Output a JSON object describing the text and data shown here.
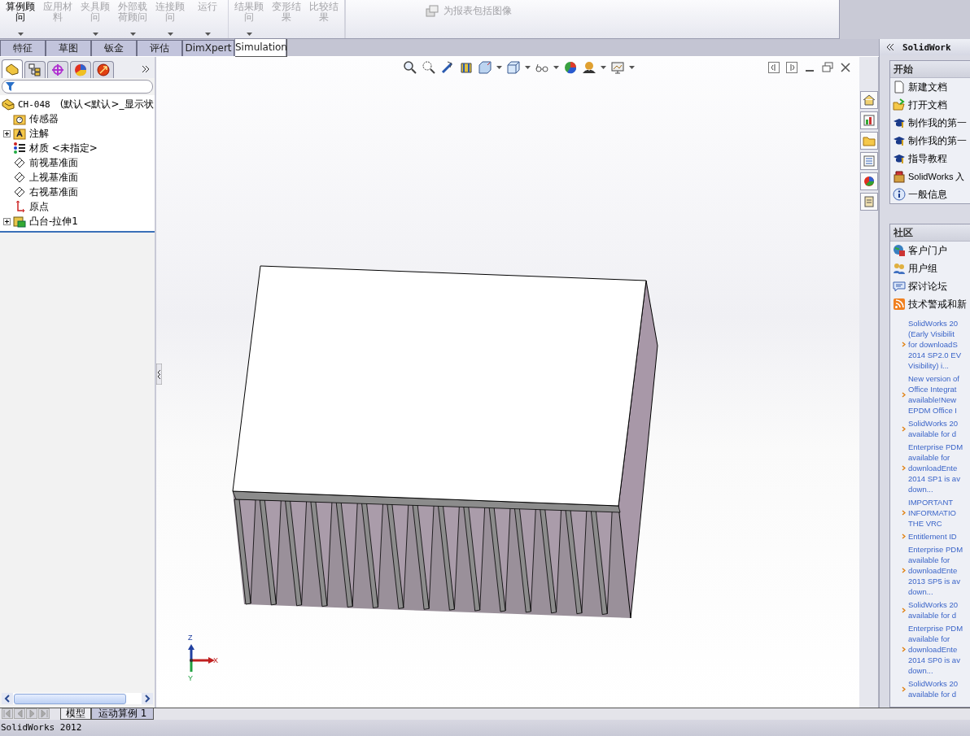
{
  "ribbon": {
    "groups": [
      {
        "buttons": [
          {
            "label": "算例顾问",
            "disabled": false,
            "dropdown": true
          },
          {
            "label": "应用材料",
            "disabled": true,
            "dropdown": false
          },
          {
            "label": "夹具顾问",
            "disabled": true,
            "dropdown": true
          },
          {
            "label": "外部载荷顾问",
            "disabled": true,
            "dropdown": true
          },
          {
            "label": "连接顾问",
            "disabled": true,
            "dropdown": true
          },
          {
            "label": "运行",
            "disabled": true,
            "dropdown": true
          }
        ]
      },
      {
        "buttons": [
          {
            "label": "结果顾问",
            "disabled": true,
            "dropdown": true
          },
          {
            "label": "变形结果",
            "disabled": true,
            "dropdown": false
          },
          {
            "label": "比较结果",
            "disabled": true,
            "dropdown": false
          }
        ]
      }
    ],
    "report_button": {
      "label": "为报表包括图像",
      "disabled": true
    }
  },
  "tabs": [
    {
      "label": "特征",
      "selected": false
    },
    {
      "label": "草图",
      "selected": false
    },
    {
      "label": "钣金",
      "selected": false
    },
    {
      "label": "评估",
      "selected": false
    },
    {
      "label": "DimXpert",
      "selected": false
    },
    {
      "label": "Simulation",
      "selected": true
    }
  ],
  "feature_tree": {
    "panel_tabs": [
      {
        "selected": true
      },
      {
        "selected": false
      },
      {
        "selected": false
      },
      {
        "selected": false
      },
      {
        "selected": false
      }
    ],
    "root": {
      "name": "CH-048",
      "config": "(默认<默认>_显示状"
    },
    "items": [
      {
        "kind": "sensor",
        "label": "传感器",
        "expander": false
      },
      {
        "kind": "annotation",
        "label": "注解",
        "expander": true
      },
      {
        "kind": "material",
        "label": "材质 <未指定>",
        "expander": false
      },
      {
        "kind": "plane",
        "label": "前视基准面",
        "expander": false
      },
      {
        "kind": "plane",
        "label": "上视基准面",
        "expander": false
      },
      {
        "kind": "plane",
        "label": "右视基准面",
        "expander": false
      },
      {
        "kind": "origin",
        "label": "原点",
        "expander": false
      },
      {
        "kind": "feature",
        "label": "凸台-拉伸1",
        "expander": true
      }
    ]
  },
  "triad": {
    "z": "Z",
    "x": "X",
    "y": "Y"
  },
  "task_pane": {
    "title": "SolidWork",
    "sections": [
      {
        "title": "开始",
        "items": [
          {
            "kind": "document",
            "label": "新建文档"
          },
          {
            "kind": "open",
            "label": "打开文档"
          },
          {
            "kind": "tutorial",
            "label": "制作我的第一"
          },
          {
            "kind": "tutorial",
            "label": "制作我的第一"
          },
          {
            "kind": "tutorial",
            "label": "指导教程"
          },
          {
            "kind": "intro",
            "label": "SolidWorks 入"
          },
          {
            "kind": "info",
            "label": "一般信息"
          }
        ]
      },
      {
        "title": "社区",
        "items": [
          {
            "kind": "portal",
            "label": "客户门户"
          },
          {
            "kind": "group",
            "label": "用户组"
          },
          {
            "kind": "forum",
            "label": "探讨论坛"
          },
          {
            "kind": "rss",
            "label": "技术警戒和新"
          }
        ]
      }
    ],
    "news": [
      [
        "SolidWorks 20",
        "(Early Visibilit",
        "for downloadS",
        "2014 SP2.0 EV",
        "Visibility) i..."
      ],
      [
        "New version of",
        "Office Integrat",
        "available!New",
        "EPDM Office I"
      ],
      [
        "SolidWorks 20",
        "available for d"
      ],
      [
        "Enterprise PDM",
        "available for",
        "downloadEnte",
        "2014 SP1 is av",
        "down..."
      ],
      [
        "IMPORTANT",
        "INFORMATIO",
        "THE VRC"
      ],
      [
        "Entitlement ID"
      ],
      [
        "Enterprise PDM",
        "available for",
        "downloadEnte",
        "2013 SP5 is av",
        "down..."
      ],
      [
        "SolidWorks 20",
        "available for d"
      ],
      [
        "Enterprise PDM",
        "available for",
        "downloadEnte",
        "2014 SP0 is av",
        "down..."
      ],
      [
        "SolidWorks 20",
        "available for d"
      ]
    ]
  },
  "bottom_tabs": [
    {
      "label": "模型",
      "selected": true
    },
    {
      "label": "运动算例 1",
      "selected": false
    }
  ],
  "status_bar": {
    "text": "SolidWorks 2012"
  }
}
